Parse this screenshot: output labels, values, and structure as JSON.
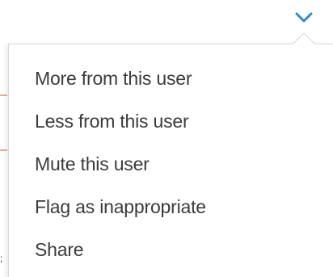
{
  "toggle": {
    "icon": "chevron-down-icon",
    "color": "#2b8bd6"
  },
  "menu": {
    "items": [
      {
        "label": "More from this user"
      },
      {
        "label": "Less from this user"
      },
      {
        "label": "Mute this user"
      },
      {
        "label": "Flag as inappropriate"
      },
      {
        "label": "Share"
      }
    ]
  }
}
